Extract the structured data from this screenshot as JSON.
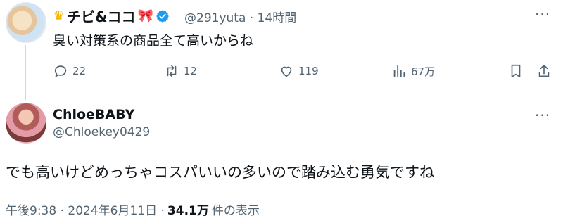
{
  "parent_tweet": {
    "display_name": "チビ&ココ",
    "name_emojis": {
      "left": "crown",
      "right": "ribbon"
    },
    "handle": "@291yuta",
    "separator": "·",
    "time": "14時間",
    "text": "臭い対策系の商品全て高いからね",
    "actions": {
      "reply_count": "22",
      "retweet_count": "12",
      "like_count": "119",
      "view_count": "67万"
    },
    "verified_color": "#1d9bf0"
  },
  "reply_tweet": {
    "display_name": "ChloeBABY",
    "handle": "@Chloekey0429",
    "text": "でも高いけどめっちゃコスパいいの多いので踏み込む勇気ですね",
    "timestamp": "午後9:38 · 2024年6月11日 ·",
    "views_value": "34.1万",
    "views_label": "件の表示"
  },
  "more_icon_glyph": "···"
}
